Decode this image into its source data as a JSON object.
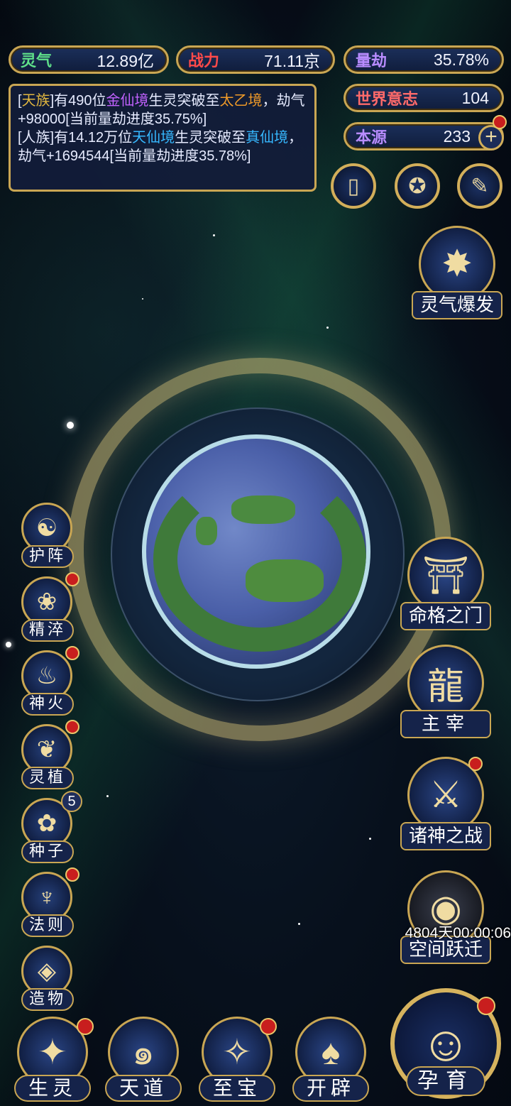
{
  "stats": {
    "lingqi": {
      "label": "灵气",
      "value": "12.89亿",
      "color": "#5fe08a"
    },
    "zhanli": {
      "label": "战力",
      "value": "71.11京",
      "color": "#ff4a4a"
    },
    "liangjie": {
      "label": "量劫",
      "value": "35.78%",
      "color": "#b88cff"
    },
    "shijie": {
      "label": "世界意志",
      "value": "104",
      "color": "#ff6a6a"
    },
    "benyuan": {
      "label": "本源",
      "value": "233",
      "color": "#b88cff"
    }
  },
  "log": {
    "line1": {
      "p1": "[",
      "race": "天族",
      "p2": "]有490位",
      "realm": "金仙境",
      "p3": "生灵突破至",
      "target": "太乙境",
      "p4": "，劫气+98000[当前量劫进度35.75%]"
    },
    "line2": {
      "p1": "[人族]有14.12万位",
      "realm": "天仙境",
      "p2": "生灵突破至",
      "target": "真仙境",
      "p3": "，劫气+1694544[当前量劫进度35.78%]"
    }
  },
  "right_buttons": {
    "lingqi_baofa": "灵气爆发",
    "mingge": "命格之门",
    "zhuzai": "主宰",
    "zhushen": "诸神之战",
    "kongjian": "空间跃迁",
    "kongjian_timer": "4804天00:00:06"
  },
  "left_buttons": [
    "护阵",
    "精淬",
    "神火",
    "灵植",
    "种子",
    "法则",
    "造物"
  ],
  "seed_badge": "5",
  "bottom_buttons": [
    "生灵",
    "天道",
    "至宝",
    "开辟"
  ],
  "yunyu": "孕育"
}
